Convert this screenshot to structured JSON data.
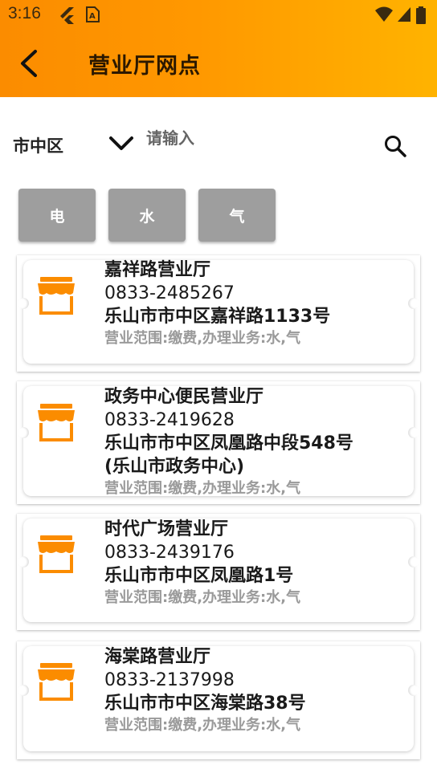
{
  "status_bar": {
    "time": "3:16"
  },
  "header": {
    "title": "营业厅网点"
  },
  "search": {
    "district": "市中区",
    "placeholder": "请输入"
  },
  "filters": [
    {
      "label": "电"
    },
    {
      "label": "水"
    },
    {
      "label": "气"
    }
  ],
  "halls": [
    {
      "name": "嘉祥路营业厅",
      "phone": "0833-2485267",
      "address": "乐山市市中区嘉祥路1133号",
      "address2": "",
      "scope": "营业范围:缴费,办理业务:水,气"
    },
    {
      "name": "政务中心便民营业厅",
      "phone": "0833-2419628",
      "address": "乐山市市中区凤凰路中段548号",
      "address2": "(乐山市政务中心)",
      "scope": "营业范围:缴费,办理业务:水,气"
    },
    {
      "name": "时代广场营业厅",
      "phone": "0833-2439176",
      "address": "乐山市市中区凤凰路1号",
      "address2": "",
      "scope": "营业范围:缴费,办理业务:水,气"
    },
    {
      "name": "海棠路营业厅",
      "phone": "0833-2137998",
      "address": "乐山市市中区海棠路38号",
      "address2": "",
      "scope": "营业范围:缴费,办理业务:水,气"
    }
  ],
  "colors": {
    "header_start": "#fb8c00",
    "header_end": "#ffb300",
    "filter_bg": "#9e9e9e",
    "shop_icon": "#fb8c00"
  }
}
